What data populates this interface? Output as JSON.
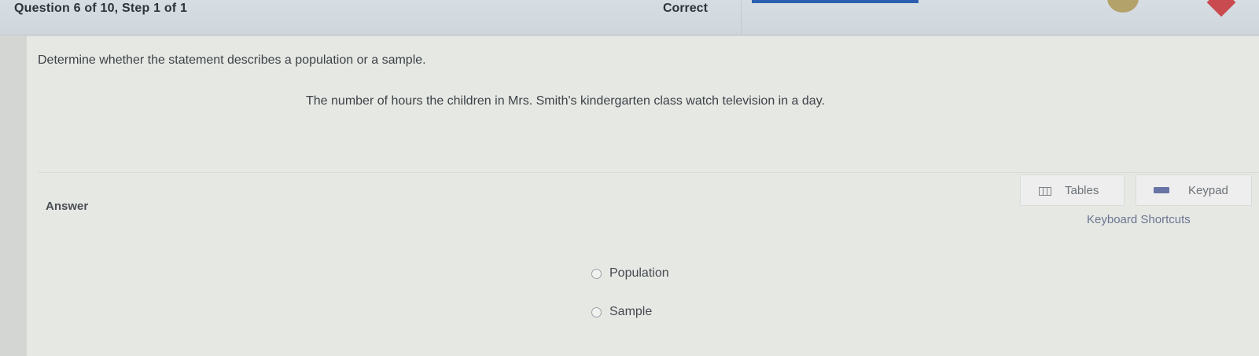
{
  "header": {
    "question_progress": "Question 6 of 10, Step 1 of 1",
    "status": "Correct"
  },
  "question": {
    "prompt": "Determine whether the statement describes a population or a sample.",
    "statement": "The number of hours the children in Mrs. Smith's kindergarten class watch television in a day."
  },
  "answer": {
    "label": "Answer",
    "tools": {
      "tables_label": "Tables",
      "keypad_label": "Keypad",
      "shortcuts_label": "Keyboard Shortcuts"
    },
    "options": [
      "Population",
      "Sample"
    ]
  },
  "colors": {
    "accent": "#2d5fb0",
    "keypad_icon": "#6874a6"
  }
}
